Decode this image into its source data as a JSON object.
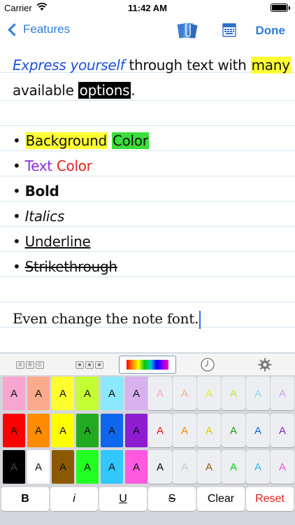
{
  "status_bar": {
    "carrier": "Carrier",
    "time": "11:42 AM"
  },
  "nav": {
    "back_label": "Features",
    "done_label": "Done"
  },
  "note": {
    "line1": {
      "a": "Express yourself",
      "b": " through text with ",
      "c": "many"
    },
    "line2": {
      "a": "available ",
      "b": "options",
      "c": "."
    },
    "bullet": "• ",
    "bg_line": {
      "a": "Background",
      "b": "Color"
    },
    "text_color": {
      "a": "Text",
      "b": "Color"
    },
    "bold": "Bold",
    "italics": "Italics",
    "underline": "Underline",
    "strikethrough": "Strikethrough",
    "last_line": "Even change the note font."
  },
  "tabs": {
    "abc": [
      "A",
      "B",
      "C"
    ]
  },
  "swatch_letter": "A",
  "colors": {
    "rows": [
      [
        "#f7a6cf",
        "#fbab8c",
        "#fffe2e",
        "#c2ff33",
        "#8ae8ff",
        "#d8b1ee"
      ],
      [
        "#ff0000",
        "#ff8c00",
        "#ffff00",
        "#22aa22",
        "#0f66ee",
        "#8e1dd0"
      ],
      [
        "#000000",
        "#ffffff",
        "#8b5a00",
        "#22ff22",
        "#30c8ff",
        "#ff5ae0"
      ]
    ],
    "text_rows": [
      [
        "#f3a6cc",
        "#f9b08a",
        "#eded20",
        "#aef030",
        "#84dcf5",
        "#cea2ec"
      ],
      [
        "#ee1111",
        "#ff8800",
        "#e2d000",
        "#18a018",
        "#1a62e6",
        "#7a2ad2"
      ],
      [
        "#000000",
        "#c8c8c8",
        "#8b5a00",
        "#10d010",
        "#2cbce8",
        "#f256d6"
      ]
    ]
  },
  "bottom": {
    "bold": "B",
    "italic": "i",
    "underline": "U",
    "strike": "S",
    "clear": "Clear",
    "reset": "Reset",
    "reset_color": "#e0201c"
  }
}
